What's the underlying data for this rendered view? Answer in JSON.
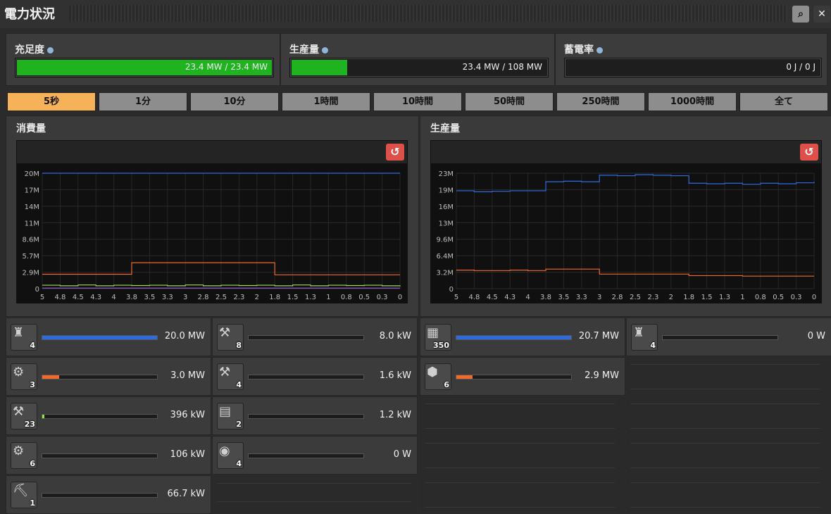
{
  "window": {
    "title": "電力状況",
    "search_label": "⌕",
    "close_label": "✕"
  },
  "stats": [
    {
      "label": "充足度",
      "value": "23.4 MW / 23.4 MW",
      "fill": 1.0
    },
    {
      "label": "生産量",
      "value": "23.4 MW / 108 MW",
      "fill": 0.217
    },
    {
      "label": "蓄電率",
      "value": "0 J / 0 J",
      "fill": 0
    }
  ],
  "colors": {
    "green": "#1fb41f",
    "blue": "#2f6be0",
    "orange": "#f06a2a",
    "lime": "#9be045",
    "violet": "#9b5be8",
    "active_tab": "#f5b259"
  },
  "tabs": [
    "5秒",
    "1分",
    "10分",
    "1時間",
    "10時間",
    "50時間",
    "250時間",
    "1000時間",
    "全て"
  ],
  "active_tab": 0,
  "charts": {
    "consumption_title": "消費量",
    "production_title": "生産量",
    "reset_label": "↺"
  },
  "chart_data": [
    {
      "type": "line",
      "title": "消費量",
      "x": [
        5,
        4.8,
        4.5,
        4.3,
        4,
        3.8,
        3.5,
        3.3,
        3,
        2.8,
        2.5,
        2.3,
        2,
        1.8,
        1.5,
        1.3,
        1,
        0.8,
        0.5,
        0.3,
        0
      ],
      "xticks": [
        "5",
        "4.8",
        "4.5",
        "4.3",
        "4",
        "3.8",
        "3.5",
        "3.3",
        "3",
        "2.8",
        "2.5",
        "2.3",
        "2",
        "1.8",
        "1.5",
        "1.3",
        "1",
        "0.8",
        "0.5",
        "0.3",
        "0"
      ],
      "yticks": [
        "20M",
        "17M",
        "14M",
        "11M",
        "8.6M",
        "5.7M",
        "2.9M",
        "0"
      ],
      "ylim": [
        0,
        20000000
      ],
      "series": [
        {
          "color": "#2f6be0",
          "values": [
            20000000,
            20000000,
            20000000,
            20000000,
            20000000,
            20000000,
            20000000,
            20000000,
            20000000,
            20000000,
            20000000,
            20000000,
            20000000,
            20000000,
            20000000,
            20000000,
            20000000,
            20000000,
            20000000,
            20000000,
            20000000
          ]
        },
        {
          "color": "#f06a2a",
          "values": [
            2500000,
            2500000,
            2500000,
            2500000,
            2500000,
            4500000,
            4500000,
            4500000,
            4500000,
            4500000,
            4500000,
            4500000,
            4500000,
            2400000,
            2400000,
            2400000,
            2400000,
            2400000,
            2400000,
            2400000,
            2400000
          ]
        },
        {
          "color": "#9be045",
          "values": [
            600000,
            500000,
            650000,
            500000,
            600000,
            550000,
            600000,
            500000,
            650000,
            500000,
            600000,
            550000,
            600000,
            500000,
            650000,
            500000,
            600000,
            550000,
            600000,
            500000,
            400000
          ]
        },
        {
          "color": "#9b5be8",
          "values": [
            100000,
            100000,
            100000,
            100000,
            100000,
            100000,
            100000,
            100000,
            100000,
            100000,
            100000,
            100000,
            100000,
            100000,
            100000,
            100000,
            100000,
            100000,
            100000,
            100000,
            100000
          ]
        }
      ],
      "grid": true
    },
    {
      "type": "line",
      "title": "生産量",
      "x": [
        5,
        4.8,
        4.5,
        4.3,
        4,
        3.8,
        3.5,
        3.3,
        3,
        2.8,
        2.5,
        2.3,
        2,
        1.8,
        1.5,
        1.3,
        1,
        0.8,
        0.5,
        0.3,
        0
      ],
      "xticks": [
        "5",
        "4.8",
        "4.5",
        "4.3",
        "4",
        "3.8",
        "3.5",
        "3.3",
        "3",
        "2.8",
        "2.5",
        "2.3",
        "2",
        "1.8",
        "1.5",
        "1.3",
        "1",
        "0.8",
        "0.5",
        "0.3",
        "0"
      ],
      "yticks": [
        "23M",
        "19M",
        "16M",
        "13M",
        "9.6M",
        "6.4M",
        "3.2M",
        "0"
      ],
      "ylim": [
        0,
        23000000
      ],
      "series": [
        {
          "color": "#2f6be0",
          "values": [
            19500000,
            19300000,
            19400000,
            19500000,
            19500000,
            21300000,
            21400000,
            21300000,
            22600000,
            22500000,
            22700000,
            22600000,
            22500000,
            21000000,
            20900000,
            21000000,
            20800000,
            21000000,
            20900000,
            21100000,
            21300000
          ]
        },
        {
          "color": "#f06a2a",
          "values": [
            3700000,
            3600000,
            3600000,
            3700000,
            3600000,
            3900000,
            3900000,
            3900000,
            2900000,
            2900000,
            2900000,
            2900000,
            2900000,
            2600000,
            2600000,
            2600000,
            2500000,
            2500000,
            2500000,
            2500000,
            2500000
          ]
        }
      ],
      "grid": true
    }
  ],
  "consumers": [
    {
      "icon": "engine-icon",
      "glyph": "♜",
      "count": "4",
      "value": "20.0 MW",
      "fill": 1.0,
      "color": "#2f6be0"
    },
    {
      "icon": "inserter-icon",
      "glyph": "⚒",
      "count": "8",
      "value": "8.0 kW",
      "fill": 0,
      "color": "#f06a2a"
    },
    {
      "icon": "lab-icon",
      "glyph": "⚙",
      "count": "3",
      "value": "3.0 MW",
      "fill": 0.15,
      "color": "#f06a2a"
    },
    {
      "icon": "fast-inserter-icon",
      "glyph": "⚒",
      "count": "4",
      "value": "1.6 kW",
      "fill": 0,
      "color": "#f06a2a"
    },
    {
      "icon": "long-inserter-icon",
      "glyph": "⚒",
      "count": "23",
      "value": "396 kW",
      "fill": 0.02,
      "color": "#9be045"
    },
    {
      "icon": "roboport-icon",
      "glyph": "▤",
      "count": "2",
      "value": "1.2 kW",
      "fill": 0,
      "color": "#f06a2a"
    },
    {
      "icon": "assembler-icon",
      "glyph": "⚙",
      "count": "6",
      "value": "106 kW",
      "fill": 0,
      "color": "#f06a2a"
    },
    {
      "icon": "radar-icon",
      "glyph": "◉",
      "count": "4",
      "value": "0 W",
      "fill": 0,
      "color": "#f06a2a"
    },
    {
      "icon": "mining-drill-icon",
      "glyph": "⛏",
      "count": "1",
      "value": "66.7 kW",
      "fill": 0,
      "color": "#f06a2a"
    }
  ],
  "producers": [
    {
      "icon": "solar-panel-icon",
      "glyph": "▦",
      "count": "350",
      "value": "20.7 MW",
      "fill": 1.0,
      "color": "#2f6be0"
    },
    {
      "icon": "steam-engine-icon",
      "glyph": "♜",
      "count": "4",
      "value": "0 W",
      "fill": 0,
      "color": "#f06a2a"
    },
    {
      "icon": "accumulator-icon",
      "glyph": "⬢",
      "count": "6",
      "value": "2.9 MW",
      "fill": 0.14,
      "color": "#f06a2a"
    }
  ]
}
